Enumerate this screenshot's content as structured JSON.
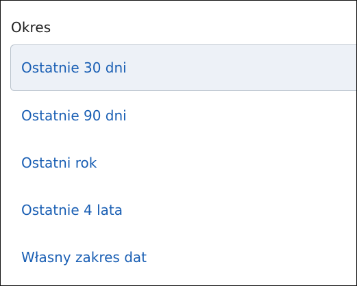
{
  "period_filter": {
    "title": "Okres",
    "selected_index": 0,
    "options": [
      {
        "label": "Ostatnie 30 dni"
      },
      {
        "label": "Ostatnie 90 dni"
      },
      {
        "label": "Ostatni rok"
      },
      {
        "label": "Ostatnie 4 lata"
      },
      {
        "label": "Własny zakres dat"
      }
    ]
  },
  "colors": {
    "link": "#1a5fb4",
    "selected_background": "#edf1f7",
    "selected_border": "#b9c2cc",
    "frame_border": "#111111"
  }
}
